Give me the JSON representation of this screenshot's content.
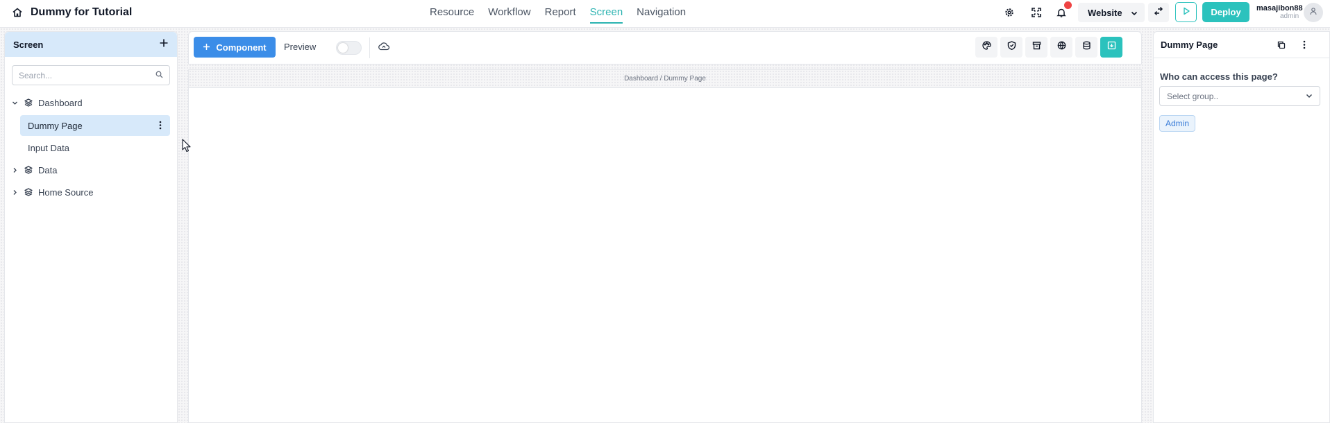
{
  "app": {
    "title": "Dummy for Tutorial"
  },
  "nav": {
    "items": [
      {
        "label": "Resource",
        "active": false
      },
      {
        "label": "Workflow",
        "active": false
      },
      {
        "label": "Report",
        "active": false
      },
      {
        "label": "Screen",
        "active": true
      },
      {
        "label": "Navigation",
        "active": false
      }
    ]
  },
  "topbar": {
    "icons": [
      "gear-icon",
      "expand-icon",
      "bell-icon"
    ],
    "environment": "Website",
    "deploy_label": "Deploy",
    "user": {
      "name": "masajibon88",
      "role": "admin"
    }
  },
  "screen_panel": {
    "title": "Screen",
    "search_placeholder": "Search...",
    "tree": [
      {
        "label": "Dashboard",
        "expanded": true,
        "children": [
          {
            "label": "Dummy Page",
            "selected": true
          },
          {
            "label": "Input Data",
            "selected": false
          }
        ]
      },
      {
        "label": "Data",
        "expanded": false
      },
      {
        "label": "Home Source",
        "expanded": false
      }
    ]
  },
  "toolbar": {
    "component_label": "Component",
    "preview_label": "Preview",
    "preview_on": false,
    "tools": [
      "palette-icon",
      "shield-icon",
      "archive-icon",
      "globe-icon",
      "database-icon",
      "save-icon"
    ]
  },
  "canvas": {
    "breadcrumb": "Dashboard / Dummy Page"
  },
  "properties": {
    "title": "Dummy Page",
    "access_label": "Who can access this page?",
    "select_placeholder": "Select group..",
    "groups": [
      "Admin"
    ]
  },
  "colors": {
    "accent": "#2bc2bd",
    "primary": "#3b8de8",
    "selected_bg": "#d7e9fa",
    "alert": "#ef4444"
  }
}
